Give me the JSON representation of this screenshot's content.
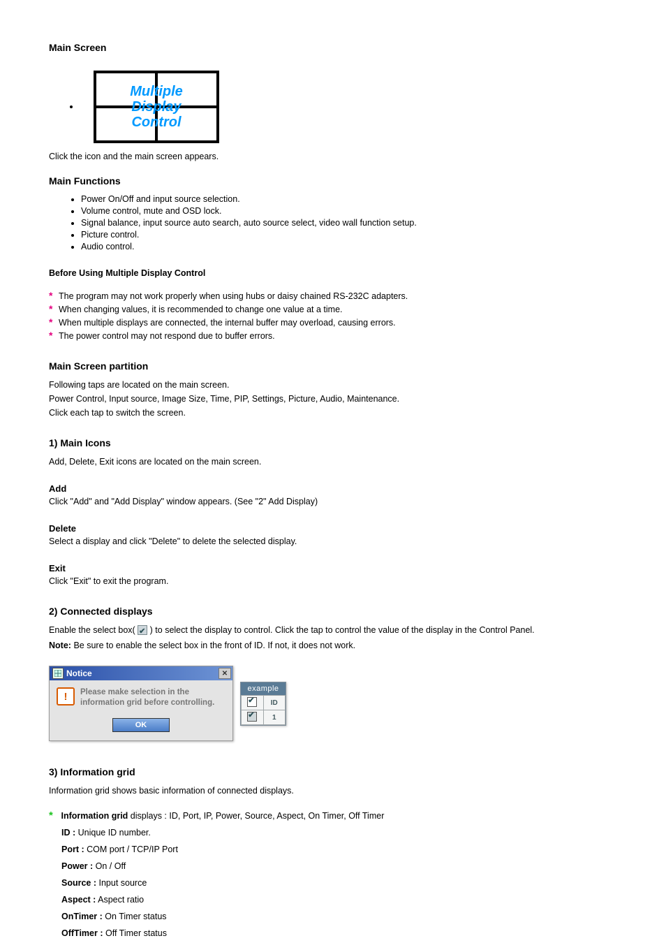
{
  "section": {
    "title": "Main Screen"
  },
  "logo": {
    "line1": "Multiple",
    "line2": "Display",
    "line3": "Control"
  },
  "intro": {
    "text": "Click the icon and the main screen appears."
  },
  "functions": {
    "heading": "Main Functions",
    "items": [
      "Power On/Off and input source selection.",
      "Volume control, mute and OSD lock.",
      "Signal balance, input source auto search, auto source select, video wall function setup.",
      "Picture control.",
      "Audio control."
    ]
  },
  "cautions": {
    "intro": "Before Using Multiple Display Control",
    "items": [
      "The program may not work properly when using hubs or daisy chained RS-232C adapters.",
      "When changing values, it is recommended to change one value at a time.",
      "When multiple displays are connected, the internal buffer may overload, causing errors.",
      "The power control may not respond due to buffer errors."
    ]
  },
  "partition": {
    "title": "Main Screen partition",
    "p1": "Following taps are located on the main screen.",
    "p2": "Power Control, Input source, Image Size, Time, PIP, Settings, Picture, Audio, Maintenance.",
    "p3": "Click each tap to switch the screen."
  },
  "icons": {
    "title": "1) Main Icons",
    "desc": "Add, Delete, Exit icons are located on the main screen.",
    "add": {
      "label": "Add",
      "desc": "Click \"Add\" and \"Add Display\" window appears. (See \"2\" Add Display)"
    },
    "del": {
      "label": "Delete",
      "desc": "Select a display and click \"Delete\" to delete the selected display."
    },
    "exit": {
      "label": "Exit",
      "desc": "Click \"Exit\" to exit the program."
    }
  },
  "connected": {
    "title": "2) Connected displays",
    "p": "Enable the select box(       ) to select the display to control. Click the tap to control the value of the display in the Control Panel.",
    "note_label": "Note:",
    "note_body": "Be sure to enable the select box in the front of ID. If not, it does not work."
  },
  "notice_dialog": {
    "title": "Notice",
    "msg": "Please make selection in the information grid before controlling.",
    "ok": "OK"
  },
  "example": {
    "title": "example",
    "head_id": "ID",
    "row1": "1"
  },
  "info_grid": {
    "title": "3) Information grid",
    "desc": "Information grid shows basic information of connected displays.",
    "item_label1": "Information grid",
    "item_text1": "displays : ID, Port, IP, Power, Source, Aspect, On Timer, Off Timer",
    "sub_id_label": "ID :",
    "sub_id_text": "Unique ID number.",
    "sub_port_label": "Port :",
    "sub_port_text": "COM port / TCP/IP Port",
    "sub_power_label": "Power :",
    "sub_power_text": "On / Off",
    "sub_source_label": "Source :",
    "sub_source_text": "Input source",
    "sub_aspect_label": "Aspect :",
    "sub_aspect_text": "Aspect ratio",
    "sub_ontimer_label": "OnTimer :",
    "sub_ontimer_text": "On Timer status",
    "sub_offtimer_label": "OffTimer :",
    "sub_offtimer_text": "Off Timer status"
  }
}
